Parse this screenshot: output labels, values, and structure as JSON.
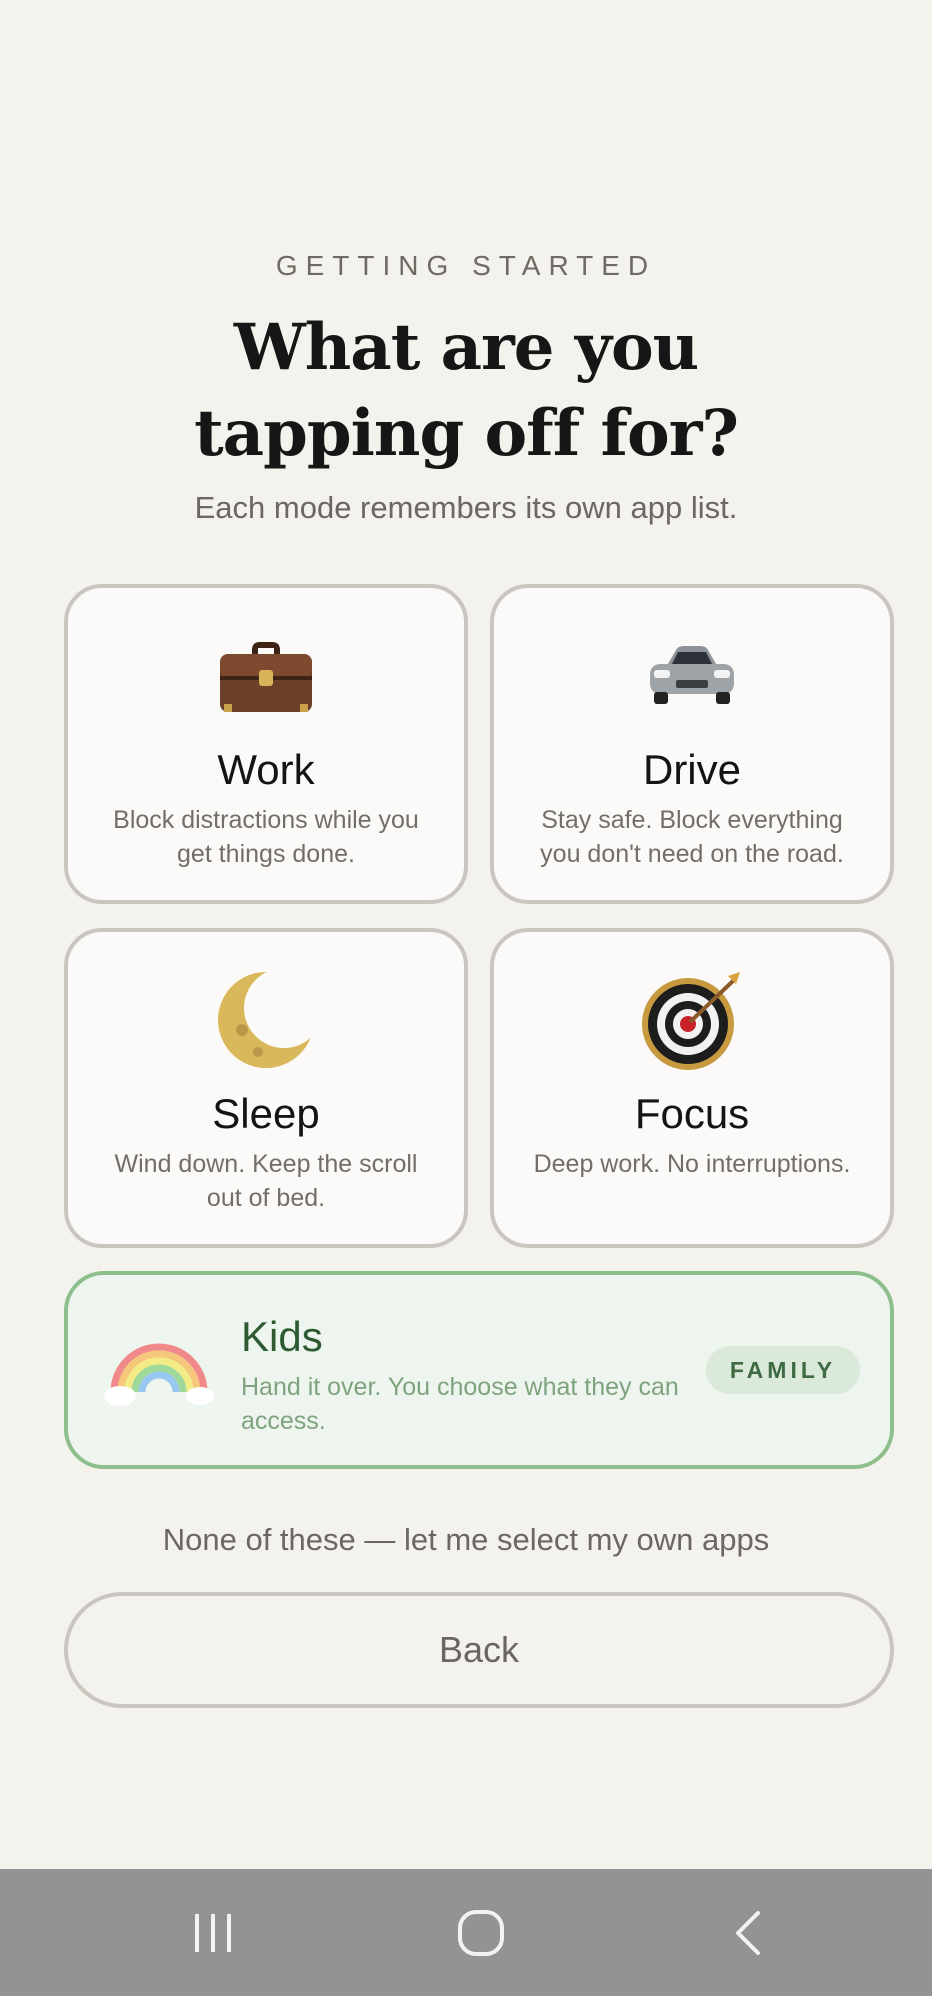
{
  "header": {
    "eyebrow": "GETTING STARTED",
    "title": "What are you tapping off for?",
    "subtitle": "Each mode remembers its own app list."
  },
  "modes": [
    {
      "name": "Work",
      "description": "Block distractions while you get things done.",
      "icon": "briefcase-icon"
    },
    {
      "name": "Drive",
      "description": "Stay safe. Block everything you don't need on the road.",
      "icon": "car-icon"
    },
    {
      "name": "Sleep",
      "description": "Wind down. Keep the scroll out of bed.",
      "icon": "crescent-moon-icon"
    },
    {
      "name": "Focus",
      "description": "Deep work. No interruptions.",
      "icon": "target-icon"
    }
  ],
  "kids": {
    "name": "Kids",
    "description": "Hand it over. You choose what they can access.",
    "badge": "FAMILY",
    "icon": "rainbow-icon"
  },
  "none_link": "None of these — let me select my own apps",
  "back_label": "Back",
  "navbar": [
    "recents-icon",
    "home-icon",
    "back-icon"
  ],
  "colors": {
    "background": "#f4f2ec",
    "card_border": "#c9c6c0",
    "kids_background": "#eef5ee",
    "kids_border": "#8dbf8c",
    "kids_text": "#2e5a33",
    "navbar": "#939393"
  }
}
